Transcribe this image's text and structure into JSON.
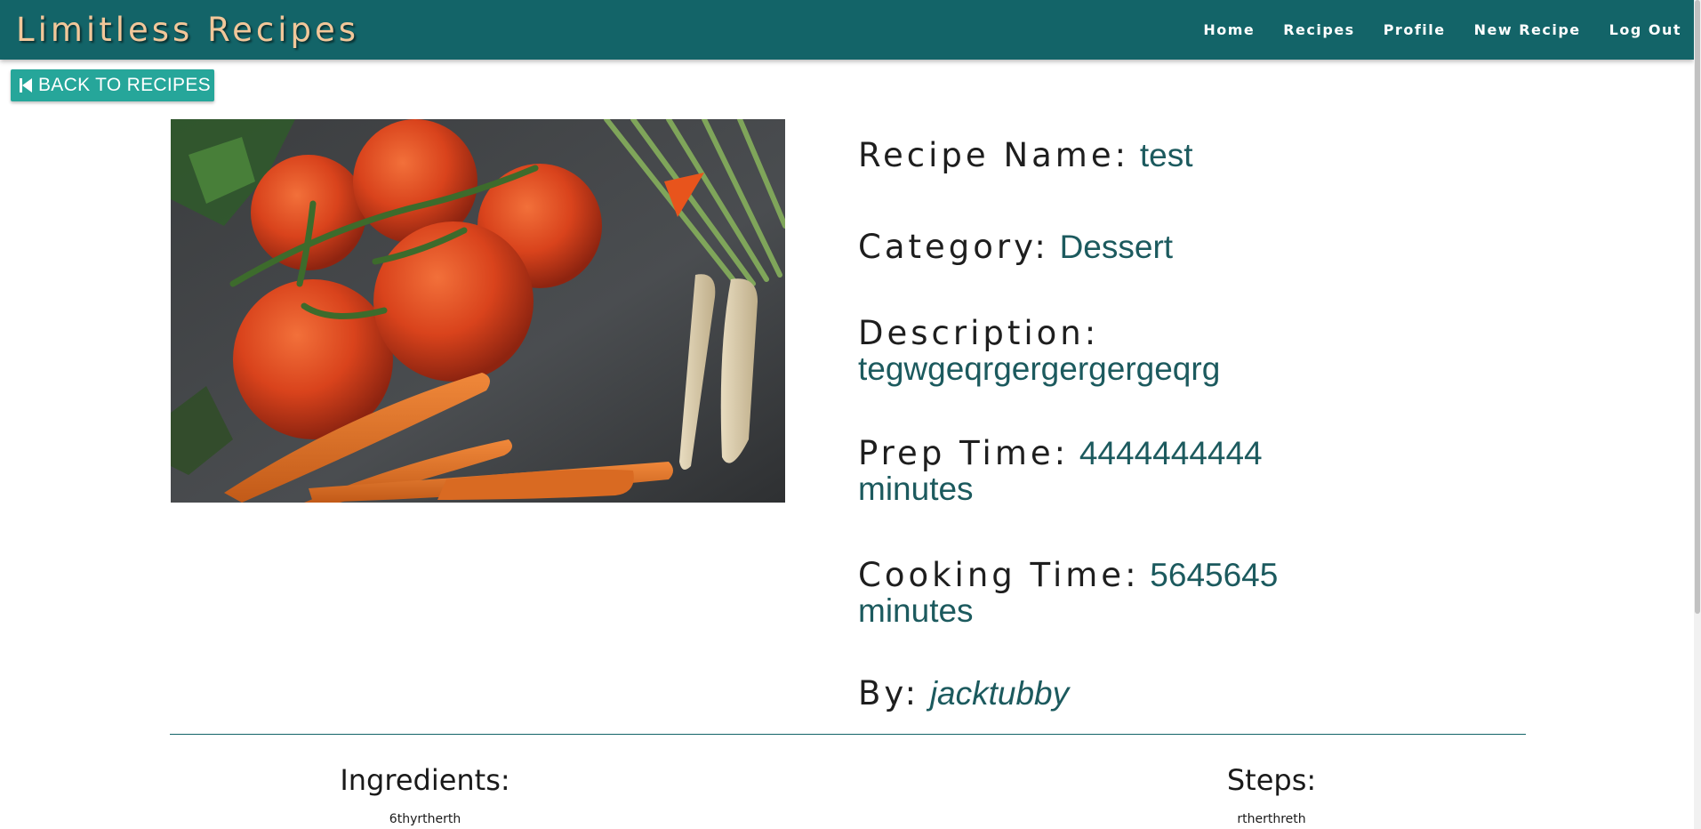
{
  "navbar": {
    "brand": "Limitless Recipes",
    "links": [
      "Home",
      "Recipes",
      "Profile",
      "New Recipe",
      "Log Out"
    ]
  },
  "back_button": {
    "label": "BACK TO RECIPES",
    "icon": "skip-previous-icon"
  },
  "image": {
    "subject": "tomatoes-and-carrots-photo"
  },
  "recipe": {
    "name_label": "Recipe Name:",
    "name": "test",
    "category_label": "Category:",
    "category": "Dessert",
    "description_label": "Description:",
    "description": "tegwgeqrgergergergeqrg",
    "prep_label": "Prep Time:",
    "prep_value": "4444444444",
    "prep_unit": "minutes",
    "cook_label": "Cooking Time:",
    "cook_value": "5645645",
    "cook_unit": "minutes",
    "by_label": "By:",
    "author": "jacktubby"
  },
  "ingredients": {
    "title": "Ingredients:",
    "items": [
      "6thyrtherth"
    ]
  },
  "steps": {
    "title": "Steps:",
    "items": [
      "rtherthreth"
    ]
  },
  "colors": {
    "navbar": "#136468",
    "brand": "#f2c79a",
    "button": "#26a69a",
    "value": "#1c5a5e"
  }
}
